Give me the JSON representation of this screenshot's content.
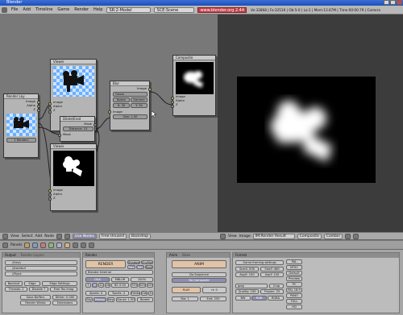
{
  "title_bar": {
    "title": "Blender"
  },
  "menubar": {
    "items": [
      "File",
      "Add",
      "Timeline",
      "Game",
      "Render",
      "Help"
    ],
    "screen": "SR:2-Model",
    "scene": "SCE:Scene",
    "url": "www.blender.org 2.44",
    "stats": "Ve:32868 | Fa:32516 | Ob:5-0 | La:1 | Mem:13.67M | Time:00:00.79 | Camera"
  },
  "node_editor": {
    "nodes": {
      "viewer_top": {
        "title": "Viewer",
        "sockets": [
          "Image",
          "Alpha",
          "Z"
        ]
      },
      "render_layers": {
        "title": "Render Lay",
        "outputs": [
          "Image",
          "Alpha",
          "Z"
        ],
        "layer_field": "1 RenderL"
      },
      "dilate_erode": {
        "title": "Dilate/Erod",
        "output": "Mask",
        "field": "Distance: 13",
        "input": "Mask"
      },
      "blur": {
        "title": "Blur",
        "output": "Image",
        "type": "Gauss",
        "toggles": [
          "Bokeh",
          "Gamma"
        ],
        "x_field": "X: 30",
        "y_field": "Y: 30",
        "input": "Image",
        "size_field": "Size: 1.00"
      },
      "viewer_bottom": {
        "title": "Viewer",
        "sockets": [
          "Image",
          "Alpha",
          "Z"
        ]
      },
      "composite": {
        "title": "Composite",
        "sockets": [
          "Image",
          "Alpha",
          "Z"
        ]
      }
    },
    "header": {
      "menus": [
        "View",
        "Select",
        "Add",
        "Node"
      ],
      "use_nodes": "Use Nodes",
      "free_unused": "Free Unused",
      "backdrop": "Backdrop"
    }
  },
  "image_editor": {
    "header": {
      "menus": [
        "View",
        "Image"
      ],
      "image_name": "IM:Render Result",
      "layer": "Composite",
      "pass": "Combin"
    }
  },
  "buttons_window": {
    "header": {
      "panels_label": "Panels"
    },
    "output_panel": {
      "tabs": [
        "Output",
        "Render Layers"
      ],
      "paths": [
        "//tmp\\",
        "//backbuf",
        "//ftype"
      ],
      "backbuf": "Backbuf",
      "edge": "Edge",
      "edge_settings": "Edge Settings",
      "threads": "Threads: 2",
      "disable_tex": "Disable T",
      "free_tex_images": "Free Tex Imag",
      "save_buffers": "Save Buffers",
      "render_window": "Render Windo",
      "dither": "Dither: 0.000",
      "extensions": "Extensions"
    },
    "render_panel": {
      "tab": "Render",
      "render_button": "RENDER",
      "shadow": "Shadow",
      "envmap": "EnvMap",
      "pano": "Pano",
      "ray": "Ray",
      "radio": "Radio",
      "renderer": "Blender Internal",
      "osa": "OSA",
      "mblur": "MBLUR",
      "osa_values": [
        "5",
        "8",
        "11",
        "16"
      ],
      "bf": "Bf: 0.50",
      "percent": [
        "100%",
        "75%",
        "50%",
        "25%"
      ],
      "xparts": "Xparts: 4",
      "yparts": "Yparts: 4",
      "fields": "Fields",
      "odd": "Odd",
      "x": "X",
      "sky": "Sky",
      "premul": "Premul",
      "key": "Key",
      "gauss": "Gauss: 1.00",
      "border": "Border"
    },
    "anim_panel": {
      "tabs": [
        "Anim",
        "Bake"
      ],
      "anim_button": "ANIM",
      "do_sequence": "Do Sequence",
      "do_composite": "Do Composite",
      "play": "PLAY",
      "rt": "rt: 0",
      "sta": "Sta: 1",
      "end": "End: 250"
    },
    "format_panel": {
      "tab": "Format",
      "game_framing": "Game framing settings",
      "sizex": "SizeX: 630",
      "sizey": "SizeY: 460",
      "aspx": "AspX: 100",
      "aspy": "AspY: 100",
      "format": "Jpeg",
      "crop": "Crop",
      "quality": "Quality: 100",
      "frs": "Frs/sec: 25",
      "bw": "BW",
      "rgb": "RGB",
      "rgba": "RGBA",
      "presets": [
        "PAL",
        "NTSC",
        "Default",
        "Preview",
        "PC",
        "PAL 16:9",
        "PANO",
        "FULL",
        "HD"
      ]
    }
  }
}
